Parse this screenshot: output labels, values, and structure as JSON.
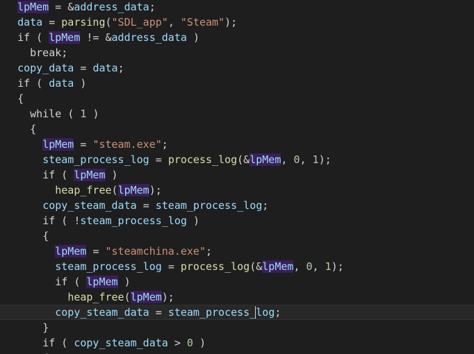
{
  "editor": {
    "current_line": 20,
    "lines": [
      "  lpMem = &address_data;",
      "  data = parsing(\"SDL_app\", \"Steam\");",
      "  if ( lpMem != &address_data )",
      "    break;",
      "  copy_data = data;",
      "  if ( data )",
      "  {",
      "    while ( 1 )",
      "    {",
      "      lpMem = \"steam.exe\";",
      "      steam_process_log = process_log(&lpMem, 0, 1);",
      "      if ( lpMem )",
      "        heap_free(lpMem);",
      "      copy_steam_data = steam_process_log;",
      "      if ( !steam_process_log )",
      "      {",
      "        lpMem = \"steamchina.exe\";",
      "        steam_process_log = process_log(&lpMem, 0, 1);",
      "        if ( lpMem )",
      "          heap_free(lpMem);",
      "        copy_steam_data = steam_process_log;",
      "      }",
      "      if ( copy_steam_data > 0 )",
      "      {"
    ]
  },
  "colors": {
    "background": "#1e1e1e",
    "identifier": "#9cdcfe",
    "string": "#ce9178",
    "number": "#b5cea8",
    "function": "#dcdcaa",
    "highlight": "#3a1f5a"
  }
}
